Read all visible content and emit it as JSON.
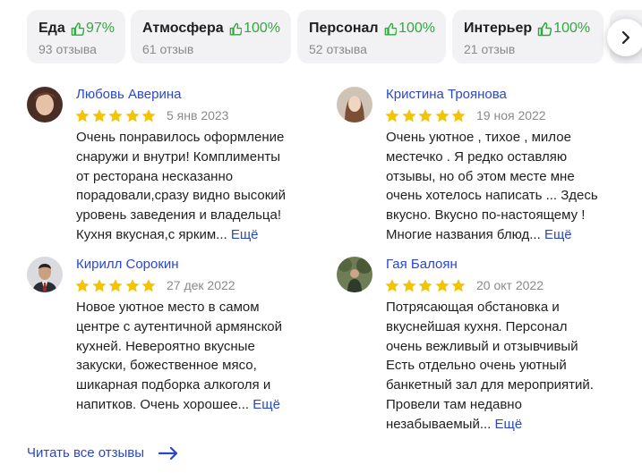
{
  "categories": [
    {
      "name": "Еда",
      "percent": "97%",
      "count": "93 отзыва"
    },
    {
      "name": "Атмосфера",
      "percent": "100%",
      "count": "61 отзыв"
    },
    {
      "name": "Персонал",
      "percent": "100%",
      "count": "52 отзыва"
    },
    {
      "name": "Интерьер",
      "percent": "100%",
      "count": "21 отзыв"
    }
  ],
  "icons": {
    "thumb": "thumb-up-icon",
    "next": "chevron-right-icon",
    "star": "star-icon",
    "read_all": "arrow-right-icon"
  },
  "colors": {
    "link": "#2a47c9",
    "positive": "#2eaa3c",
    "star": "#f5c400",
    "muted": "#8a8a8d",
    "chip_bg": "#f2f2f5"
  },
  "reviews": [
    {
      "author": "Любовь Аверина",
      "rating": 5,
      "date": "5 янв 2023",
      "lines": [
        "Очень понравилось оформление",
        "снаружи и внутри! Комплименты",
        "от ресторана несказанно",
        "порадовали,сразу видно высокий",
        "уровень заведения и владельца!",
        "Кухня вкусная,с ярким..."
      ],
      "more": "Ещё"
    },
    {
      "author": "Кристина Троянова",
      "rating": 5,
      "date": "19 ноя 2022",
      "lines": [
        "Очень уютное , тихое , милое",
        "местечко . Я редко оставляю",
        "отзывы, но об этом месте мне",
        "очень хотелось написать ... Здесь",
        "вкусно. Вкусно по-настоящему !",
        "Многие названия блюд..."
      ],
      "more": "Ещё"
    },
    {
      "author": "Кирилл Сорокин",
      "rating": 5,
      "date": "27 дек 2022",
      "lines": [
        "Новое уютное место в самом",
        "центре с аутентичной армянской",
        "кухней. Невероятно вкусные",
        "закуски, божественное мясо,",
        "шикарная подборка алкоголя и",
        "напитков. Очень хорошее..."
      ],
      "more": "Ещё"
    },
    {
      "author": "Гая Балоян",
      "rating": 5,
      "date": "20 окт 2022",
      "lines": [
        "Потрясающая обстановка и",
        "вкуснейшая кухня. Персонал",
        "очень вежливый и отзывчивый",
        "Есть отдельно очень уютный",
        "банкетный зал для мероприятий.",
        "Провели там недавно",
        "незабываемый..."
      ],
      "more": "Ещё"
    }
  ],
  "read_all_label": "Читать все отзывы"
}
